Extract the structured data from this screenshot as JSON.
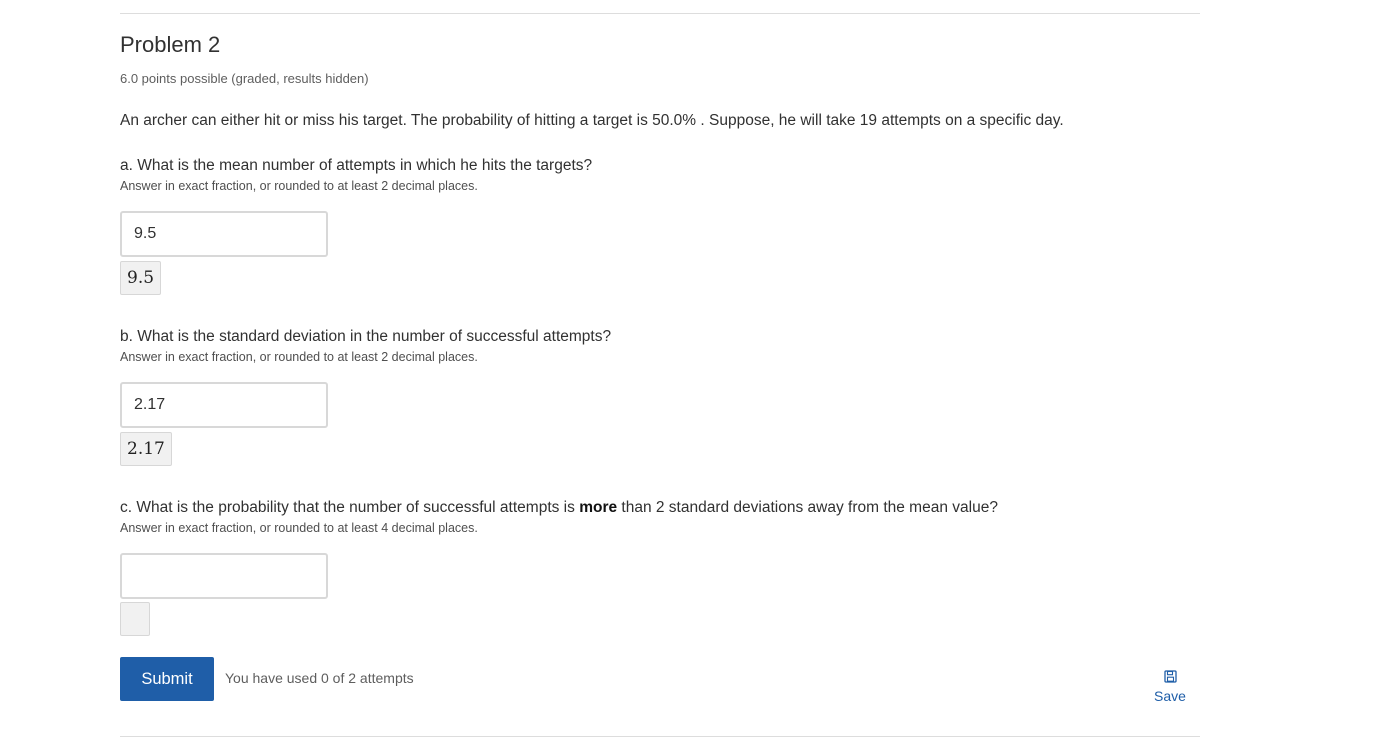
{
  "problem": {
    "title": "Problem 2",
    "points": "6.0 points possible (graded, results hidden)",
    "prompt": "An archer can either hit or miss his target. The probability of hitting a target is 50.0% . Suppose, he will take 19 attempts on a specific day."
  },
  "parts": [
    {
      "question": "a. What is the mean number of attempts in which he hits the targets?",
      "hint": "Answer in exact fraction, or rounded to at least 2 decimal places.",
      "value": "9.5",
      "preview": "9.5"
    },
    {
      "question": "b. What is the standard deviation in the number of successful attempts?",
      "hint": "Answer in exact fraction, or rounded to at least 2 decimal places.",
      "value": "2.17",
      "preview": "2.17"
    },
    {
      "question_before": "c. What is the probability that the number of successful attempts is ",
      "question_bold": "more",
      "question_after": " than 2 standard deviations away from the mean value?",
      "hint": "Answer in exact fraction, or rounded to at least 4 decimal places.",
      "value": "",
      "preview": ""
    }
  ],
  "actions": {
    "submit_label": "Submit",
    "attempts_text": "You have used 0 of 2 attempts",
    "save_label": "Save",
    "save_icon": "floppy-disk-icon"
  },
  "colors": {
    "accent": "#1f5ea8",
    "text": "#313131",
    "muted": "#5e5e5e"
  }
}
